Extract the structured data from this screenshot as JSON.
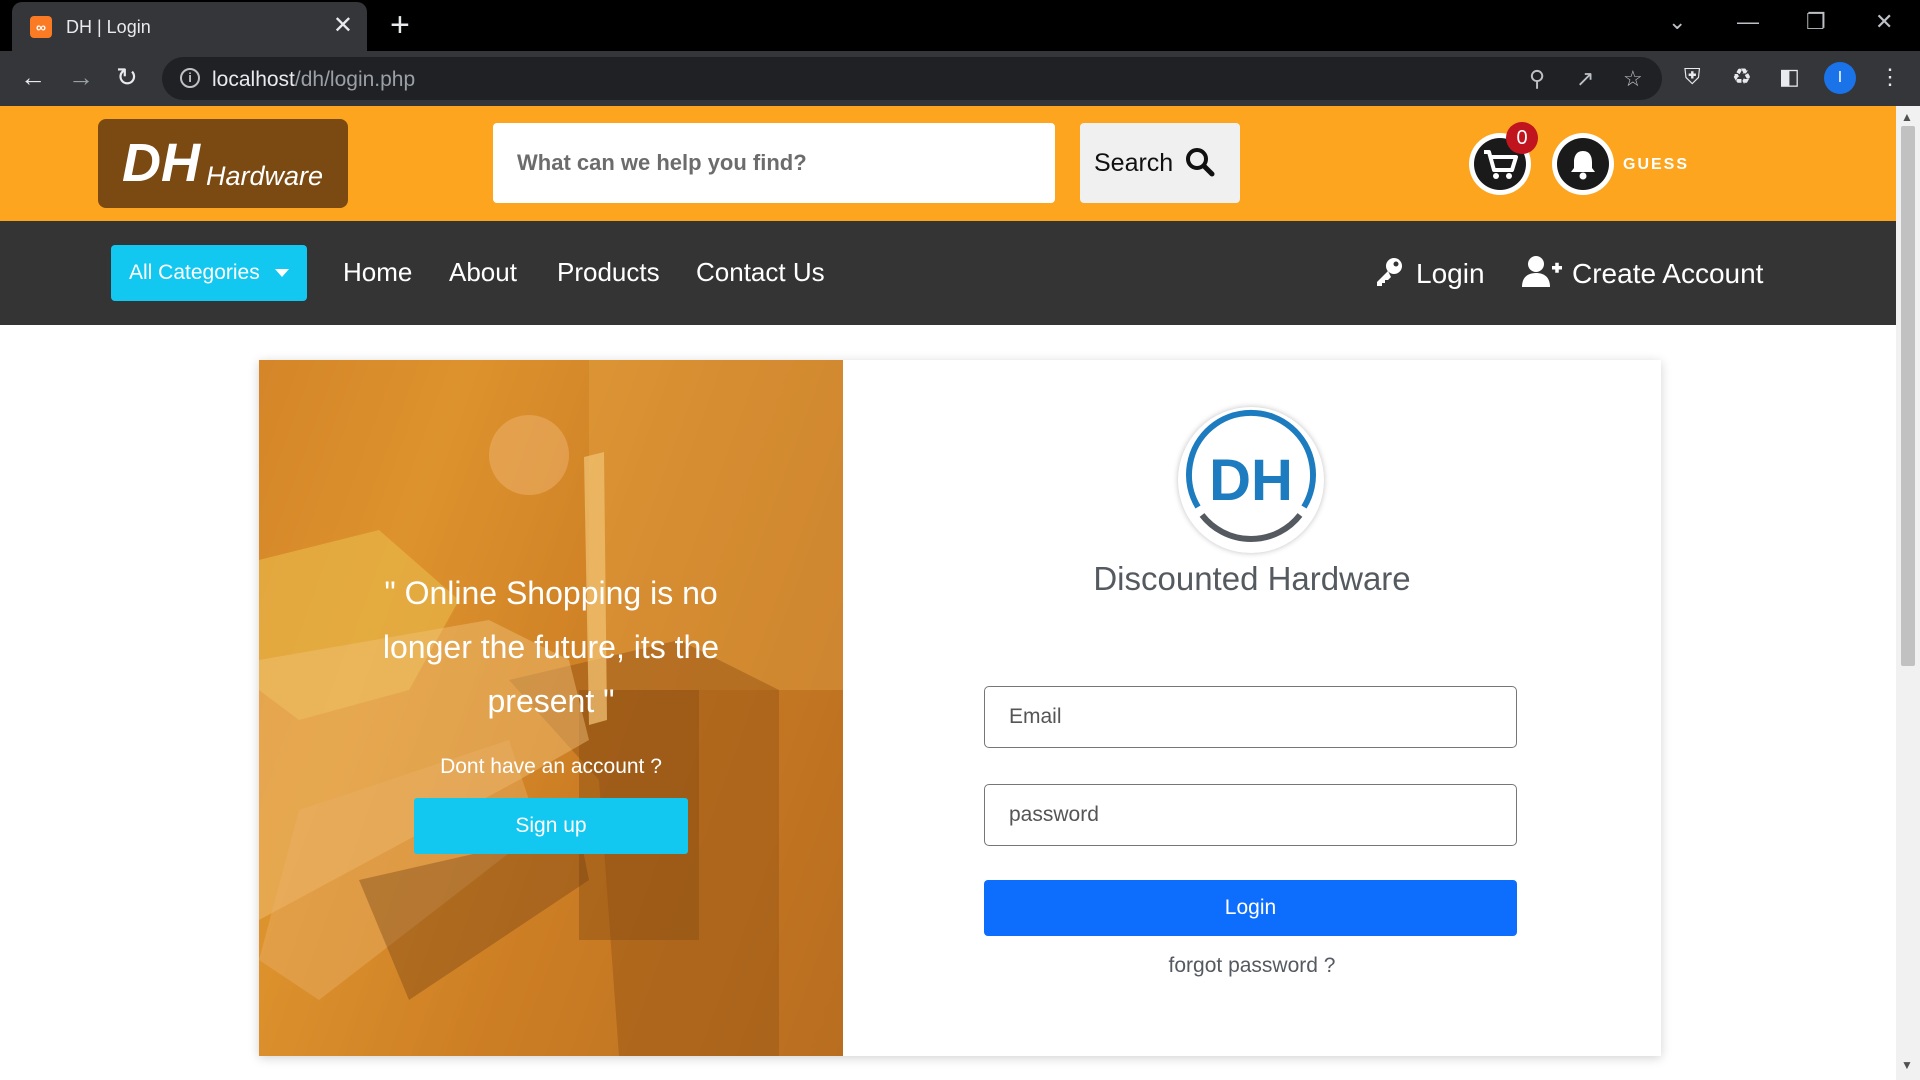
{
  "browser": {
    "tab_title": "DH | Login",
    "tab_favicon": "xampp-icon",
    "url_host": "localhost",
    "url_path": "/dh/login.php",
    "profile_initial": "I"
  },
  "header": {
    "brand_main": "DH",
    "brand_sub": "Hardware",
    "search_placeholder": "What can we help you find?",
    "search_label": "Search",
    "cart_count": "0",
    "user_label": "GUESS"
  },
  "nav": {
    "categories_label": "All Categories",
    "links": [
      "Home",
      "About",
      "Products",
      "Contact Us"
    ],
    "login_label": "Login",
    "create_account_label": "Create Account"
  },
  "hero": {
    "quote": "\" Online Shopping is no longer the future, its the present \"",
    "no_account": "Dont have an account ?",
    "signup_label": "Sign up"
  },
  "form": {
    "logo_text": "DH",
    "site_name": "Discounted Hardware",
    "email_placeholder": "Email",
    "password_placeholder": "password",
    "login_label": "Login",
    "forgot_label": "forgot password ?"
  },
  "colors": {
    "header_bg": "#fda51e",
    "brand_bg": "#7b4a12",
    "nav_bg": "#343434",
    "accent_cyan": "#13c8f0",
    "primary_blue": "#0d6efd",
    "badge_red": "#c0141f"
  }
}
